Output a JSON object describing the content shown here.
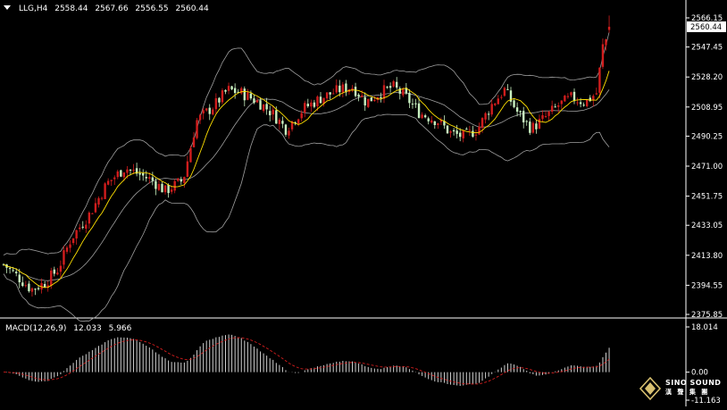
{
  "header": {
    "symbol": "LLG,H4",
    "open": "2558.44",
    "high": "2567.66",
    "low": "2556.55",
    "close": "2560.44"
  },
  "macd_header": {
    "label": "MACD(12,26,9)",
    "main": "12.033",
    "signal": "5.966"
  },
  "logo": {
    "line1": "SINO SOUND",
    "line2": "漢 聲 集 團"
  },
  "colors": {
    "background": "#000000",
    "bull": "#d11d1d",
    "bear": "#c8f0c0",
    "ma": "#ffe000",
    "band": "#a0a0a0",
    "macd_hist": "#d0d0d0",
    "macd_signal": "#d11d1d",
    "axis": "#ffffff"
  },
  "chart_data": [
    {
      "type": "candlestick",
      "ylim": [
        2375.85,
        2566.15
      ],
      "yticks": [
        "2566.15",
        "2547.45",
        "2528.20",
        "2508.95",
        "2490.25",
        "2471.00",
        "2451.75",
        "2433.05",
        "2413.80",
        "2394.55",
        "2375.85"
      ],
      "current_price": "2560.44",
      "overlays": [
        "moving-average",
        "bollinger-bands"
      ]
    },
    {
      "type": "bar",
      "name": "MACD(12,26,9)",
      "ylim": [
        -11.163,
        18.014
      ],
      "yticks": [
        "18.014",
        "0.00",
        "-11.163"
      ],
      "main": 12.033,
      "signal": 5.966
    }
  ]
}
